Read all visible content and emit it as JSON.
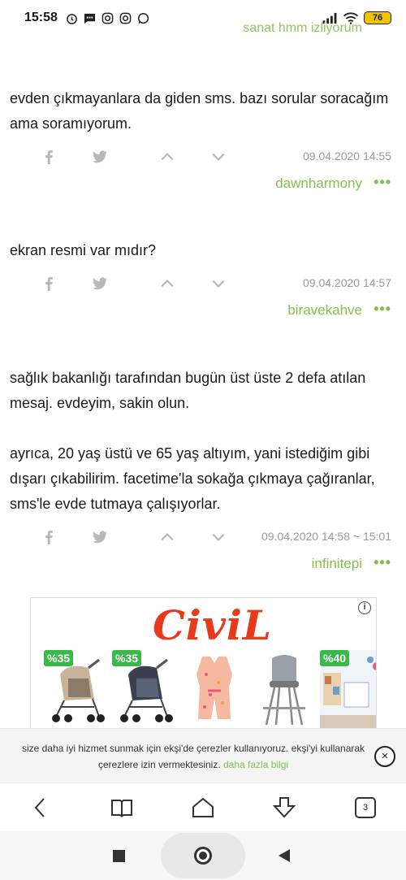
{
  "status_bar": {
    "time": "15:58",
    "battery": "76",
    "icons": [
      "alarm-icon",
      "message-icon",
      "instagram-icon",
      "instagram-icon",
      "whatsapp-icon",
      "signal-icon",
      "wifi-icon",
      "battery-icon"
    ]
  },
  "faded_author": "sanat hmm izliyorum",
  "entries": [
    {
      "paragraphs": [
        "evden çıkmayanlara da giden sms. bazı sorular soracağım ama soramıyorum."
      ],
      "date": "09.04.2020 14:55",
      "author": "dawnharmony"
    },
    {
      "paragraphs": [
        "ekran resmi var mıdır?"
      ],
      "date": "09.04.2020 14:57",
      "author": "biravekahve"
    },
    {
      "paragraphs": [
        "sağlık bakanlığı tarafından bugün üst üste 2 defa atılan mesaj. evdeyim, sakin olun.",
        "ayrıca, 20 yaş üstü ve 65 yaş altıyım, yani istediğim gibi dışarı çıkabilirim. facetime'la sokağa çıkmaya çağıranlar, sms'le evde tutmaya çalışıyorlar."
      ],
      "date": "09.04.2020 14:58 ~ 15:01",
      "author": "infinitepi"
    }
  ],
  "more_label": "•••",
  "ad": {
    "brand": "CiviL",
    "info": "i",
    "badges": [
      "%35",
      "%35",
      "%40"
    ]
  },
  "cookie": {
    "text": "size daha iyi hizmet sunmak için ekşi'de çerezler kullanıyoruz. ekşi'yi kullanarak çerezlere izin vermektesiniz.",
    "link": "daha fazla bilgi",
    "close": "×"
  },
  "browser": {
    "tab_count": "3"
  }
}
